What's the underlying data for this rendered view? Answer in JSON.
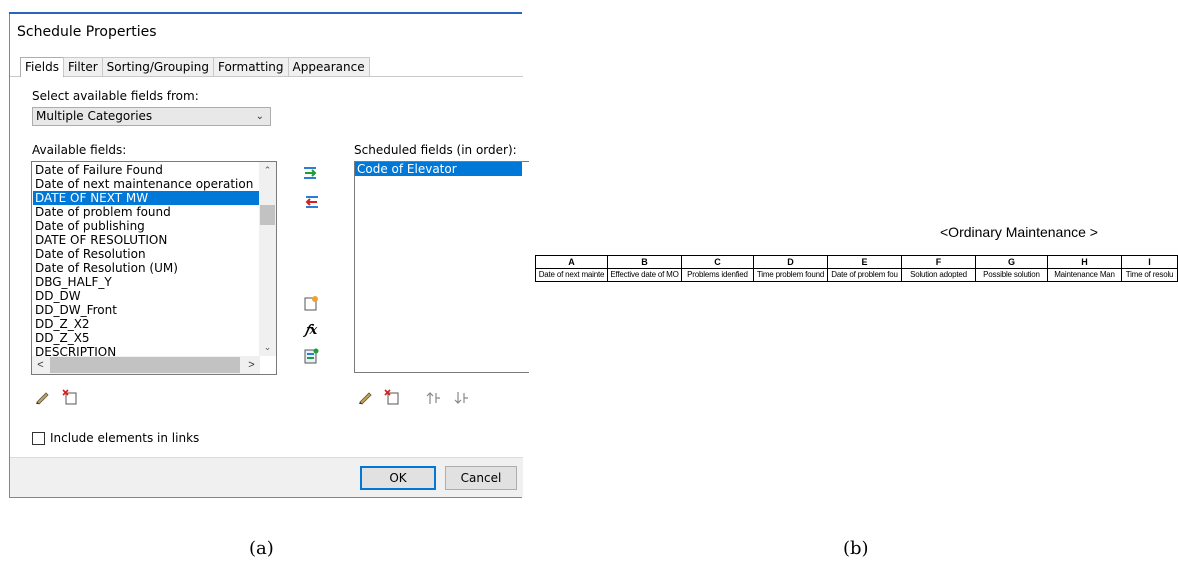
{
  "dialog": {
    "title": "Schedule Properties",
    "tabs": [
      "Fields",
      "Filter",
      "Sorting/Grouping",
      "Formatting",
      "Appearance"
    ],
    "active_tab": "Fields",
    "select_label": "Select available fields from:",
    "category_value": "Multiple Categories",
    "available_label": "Available fields:",
    "available_items": [
      "Date of Failure Found",
      "Date of next maintenance operation",
      "DATE OF NEXT MW",
      "Date of problem found",
      "Date of publishing",
      "DATE OF RESOLUTION",
      "Date of Resolution",
      "Date of Resolution (UM)",
      "DBG_HALF_Y",
      "DD_DW",
      "DD_DW_Front",
      "DD_Z_X2",
      "DD_Z_X5",
      "DESCRIPTION"
    ],
    "available_selected_index": 2,
    "scheduled_label": "Scheduled fields (in order):",
    "scheduled_items": [
      "Code of Elevator"
    ],
    "include_links_label": "Include elements in links",
    "ok_label": "OK",
    "cancel_label": "Cancel",
    "accent_color": "#0078d7"
  },
  "icons": {
    "add": "add-field-icon",
    "remove": "remove-field-icon",
    "new_param": "new-parameter-icon",
    "fx": "calculated-value-icon",
    "combine": "combine-parameters-icon",
    "edit": "edit-icon",
    "delete": "delete-icon",
    "move_up": "move-up-icon",
    "move_down": "move-down-icon"
  },
  "captions": {
    "a": "(a)",
    "b": "(b)"
  },
  "schedule": {
    "title": "<Ordinary Maintenance >",
    "column_letters": [
      "A",
      "B",
      "C",
      "D",
      "E",
      "F",
      "G",
      "H",
      "I"
    ],
    "column_headers": [
      "Date of next mainte",
      "Effective date of MO",
      "Problems idenfied",
      "Time problem found",
      "Date of problem fou",
      "Solution adopted",
      "Possible solution",
      "Maintenance Man",
      "Time of resolu"
    ]
  }
}
